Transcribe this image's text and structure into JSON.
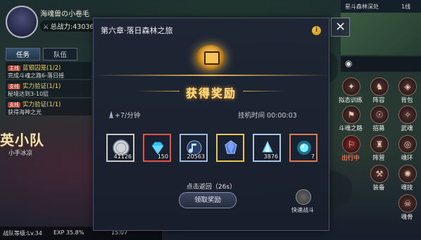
{
  "player": {
    "name": "海魂兽の小卷毛",
    "power_label": "总战力",
    "power_value": "43036"
  },
  "tabs": [
    {
      "label": "任务"
    },
    {
      "label": "队伍"
    }
  ],
  "tasks": [
    {
      "badge": "主线",
      "title": "蓝银囚笼(1/2)",
      "detail": "完成斗魂之路6-落日摇"
    },
    {
      "badge": "支线",
      "title": "实力验证(1/1)",
      "detail": "秘境达到3-10层"
    },
    {
      "badge": "支线",
      "title": "实力验证(1/1)",
      "detail": "获得海神之光"
    }
  ],
  "team_panel": {
    "title": "英小队",
    "subtitle": "小手冰凉"
  },
  "bottom_bar": {
    "level": "战队等级:Lv.34",
    "exp": "EXP 35.8%",
    "time": "15:07"
  },
  "map": {
    "area": "星斗森林深处",
    "line": "1线"
  },
  "right_menu": [
    {
      "label": "拟态训练"
    },
    {
      "label": "阵容"
    },
    {
      "label": "背包"
    },
    {
      "label": "斗魂之路"
    },
    {
      "label": "招募"
    },
    {
      "label": "武魂"
    },
    {
      "label": "出行中"
    },
    {
      "label": "阵营"
    },
    {
      "label": "魂环"
    },
    {
      "label": "装备"
    },
    {
      "label": "魂技"
    },
    {
      "label": "魂骨"
    }
  ],
  "modal": {
    "title": "第六章·落日森林之旅",
    "info_icon": "i",
    "close_icon": "×",
    "reward_title": "获得奖励",
    "rate": "+7/分钟",
    "idle_label": "挂机时间",
    "idle_time": "00:00:03",
    "countdown": "点击返回（26s）",
    "claim_label": "领取奖励",
    "quick_battle_label": "快速战斗",
    "rewards": [
      {
        "name": "silver-coin",
        "count": "41126",
        "border": "#c9c9c9"
      },
      {
        "name": "red-diamond",
        "count": "150",
        "border": "#e0524a"
      },
      {
        "name": "blue-crystal-note",
        "count": "20563",
        "border": "#9fb7d8"
      },
      {
        "name": "gold-gem",
        "count": "",
        "border": "#e8c84a"
      },
      {
        "name": "blue-crystal-shard",
        "count": "3876",
        "border": "#a9c7e0"
      },
      {
        "name": "soul-orb",
        "count": "7",
        "border": "#d87a52"
      }
    ]
  }
}
